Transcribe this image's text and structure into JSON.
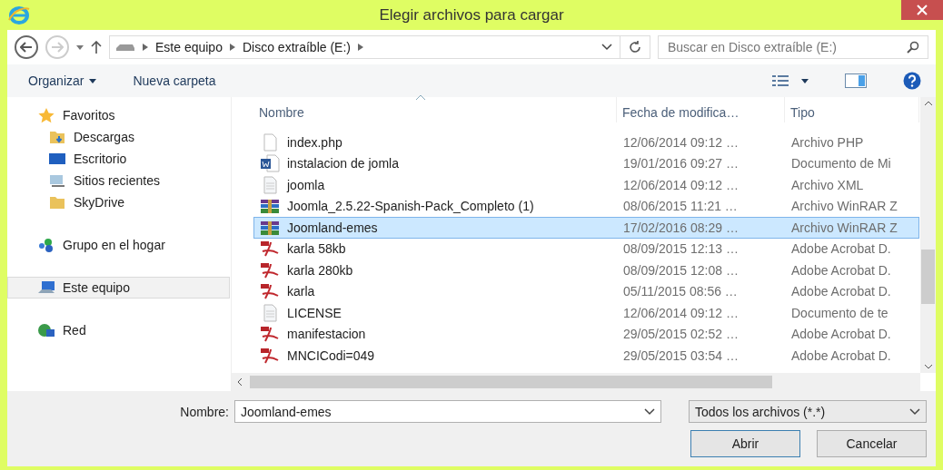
{
  "window": {
    "title": "Elegir archivos para cargar"
  },
  "navigation": {
    "path": [
      "Este equipo",
      "Disco extraíble (E:)"
    ],
    "search": {
      "placeholder": "Buscar en Disco extraíble (E:)"
    }
  },
  "toolbar": {
    "organize": "Organizar",
    "new_folder": "Nueva carpeta"
  },
  "sidebar": {
    "items": [
      {
        "label": "Favoritos",
        "kind": "star",
        "selected": false,
        "children": [
          {
            "label": "Descargas",
            "kind": "downloads",
            "selected": false
          },
          {
            "label": "Escritorio",
            "kind": "desktop",
            "selected": false
          },
          {
            "label": "Sitios recientes",
            "kind": "recent",
            "selected": false
          },
          {
            "label": "SkyDrive",
            "kind": "folder",
            "selected": false
          }
        ]
      },
      {
        "label": "Grupo en el hogar",
        "kind": "homegroup",
        "selected": false
      },
      {
        "label": "Este equipo",
        "kind": "computer",
        "selected": true
      },
      {
        "label": "Red",
        "kind": "network",
        "selected": false
      }
    ]
  },
  "table": {
    "columns": [
      "Nombre",
      "Fecha de modifica…",
      "Tipo"
    ],
    "rows": [
      {
        "name": "index.php",
        "date": "12/06/2014 09:12 …",
        "type": "Archivo PHP",
        "kind": "blank",
        "selected": false
      },
      {
        "name": "instalacion de jomla",
        "date": "19/01/2016 09:27 …",
        "type": "Documento de Mi",
        "kind": "word",
        "selected": false
      },
      {
        "name": "joomla",
        "date": "12/06/2014 09:12 …",
        "type": "Archivo XML",
        "kind": "text",
        "selected": false
      },
      {
        "name": "Joomla_2.5.22-Spanish-Pack_Completo (1)",
        "date": "08/06/2015 11:21 …",
        "type": "Archivo WinRAR Z",
        "kind": "archive",
        "selected": false
      },
      {
        "name": "Joomland-emes",
        "date": "17/02/2016 08:29 …",
        "type": "Archivo WinRAR Z",
        "kind": "archive",
        "selected": true
      },
      {
        "name": "karla 58kb",
        "date": "08/09/2015 12:13 …",
        "type": "Adobe Acrobat D.",
        "kind": "pdf",
        "selected": false
      },
      {
        "name": "karla 280kb",
        "date": "08/09/2015 12:08 …",
        "type": "Adobe Acrobat D.",
        "kind": "pdf",
        "selected": false
      },
      {
        "name": "karla",
        "date": "05/11/2015 08:56 …",
        "type": "Adobe Acrobat D.",
        "kind": "pdf",
        "selected": false
      },
      {
        "name": "LICENSE",
        "date": "12/06/2014 09:12 …",
        "type": "Documento de te",
        "kind": "text",
        "selected": false
      },
      {
        "name": "manifestacion",
        "date": "29/05/2015 02:52 …",
        "type": "Adobe Acrobat D.",
        "kind": "pdf",
        "selected": false
      },
      {
        "name": "MNCICodi=049",
        "date": "29/05/2015 03:54 …",
        "type": "Adobe Acrobat D.",
        "kind": "pdf",
        "selected": false
      }
    ]
  },
  "footer": {
    "filename_label": "Nombre:",
    "filename": "Joomland-emes",
    "filter": "Todos los archivos (*.*)",
    "buttons": [
      {
        "label": "Abrir",
        "default": true
      },
      {
        "label": "Cancelar",
        "default": false
      }
    ]
  }
}
